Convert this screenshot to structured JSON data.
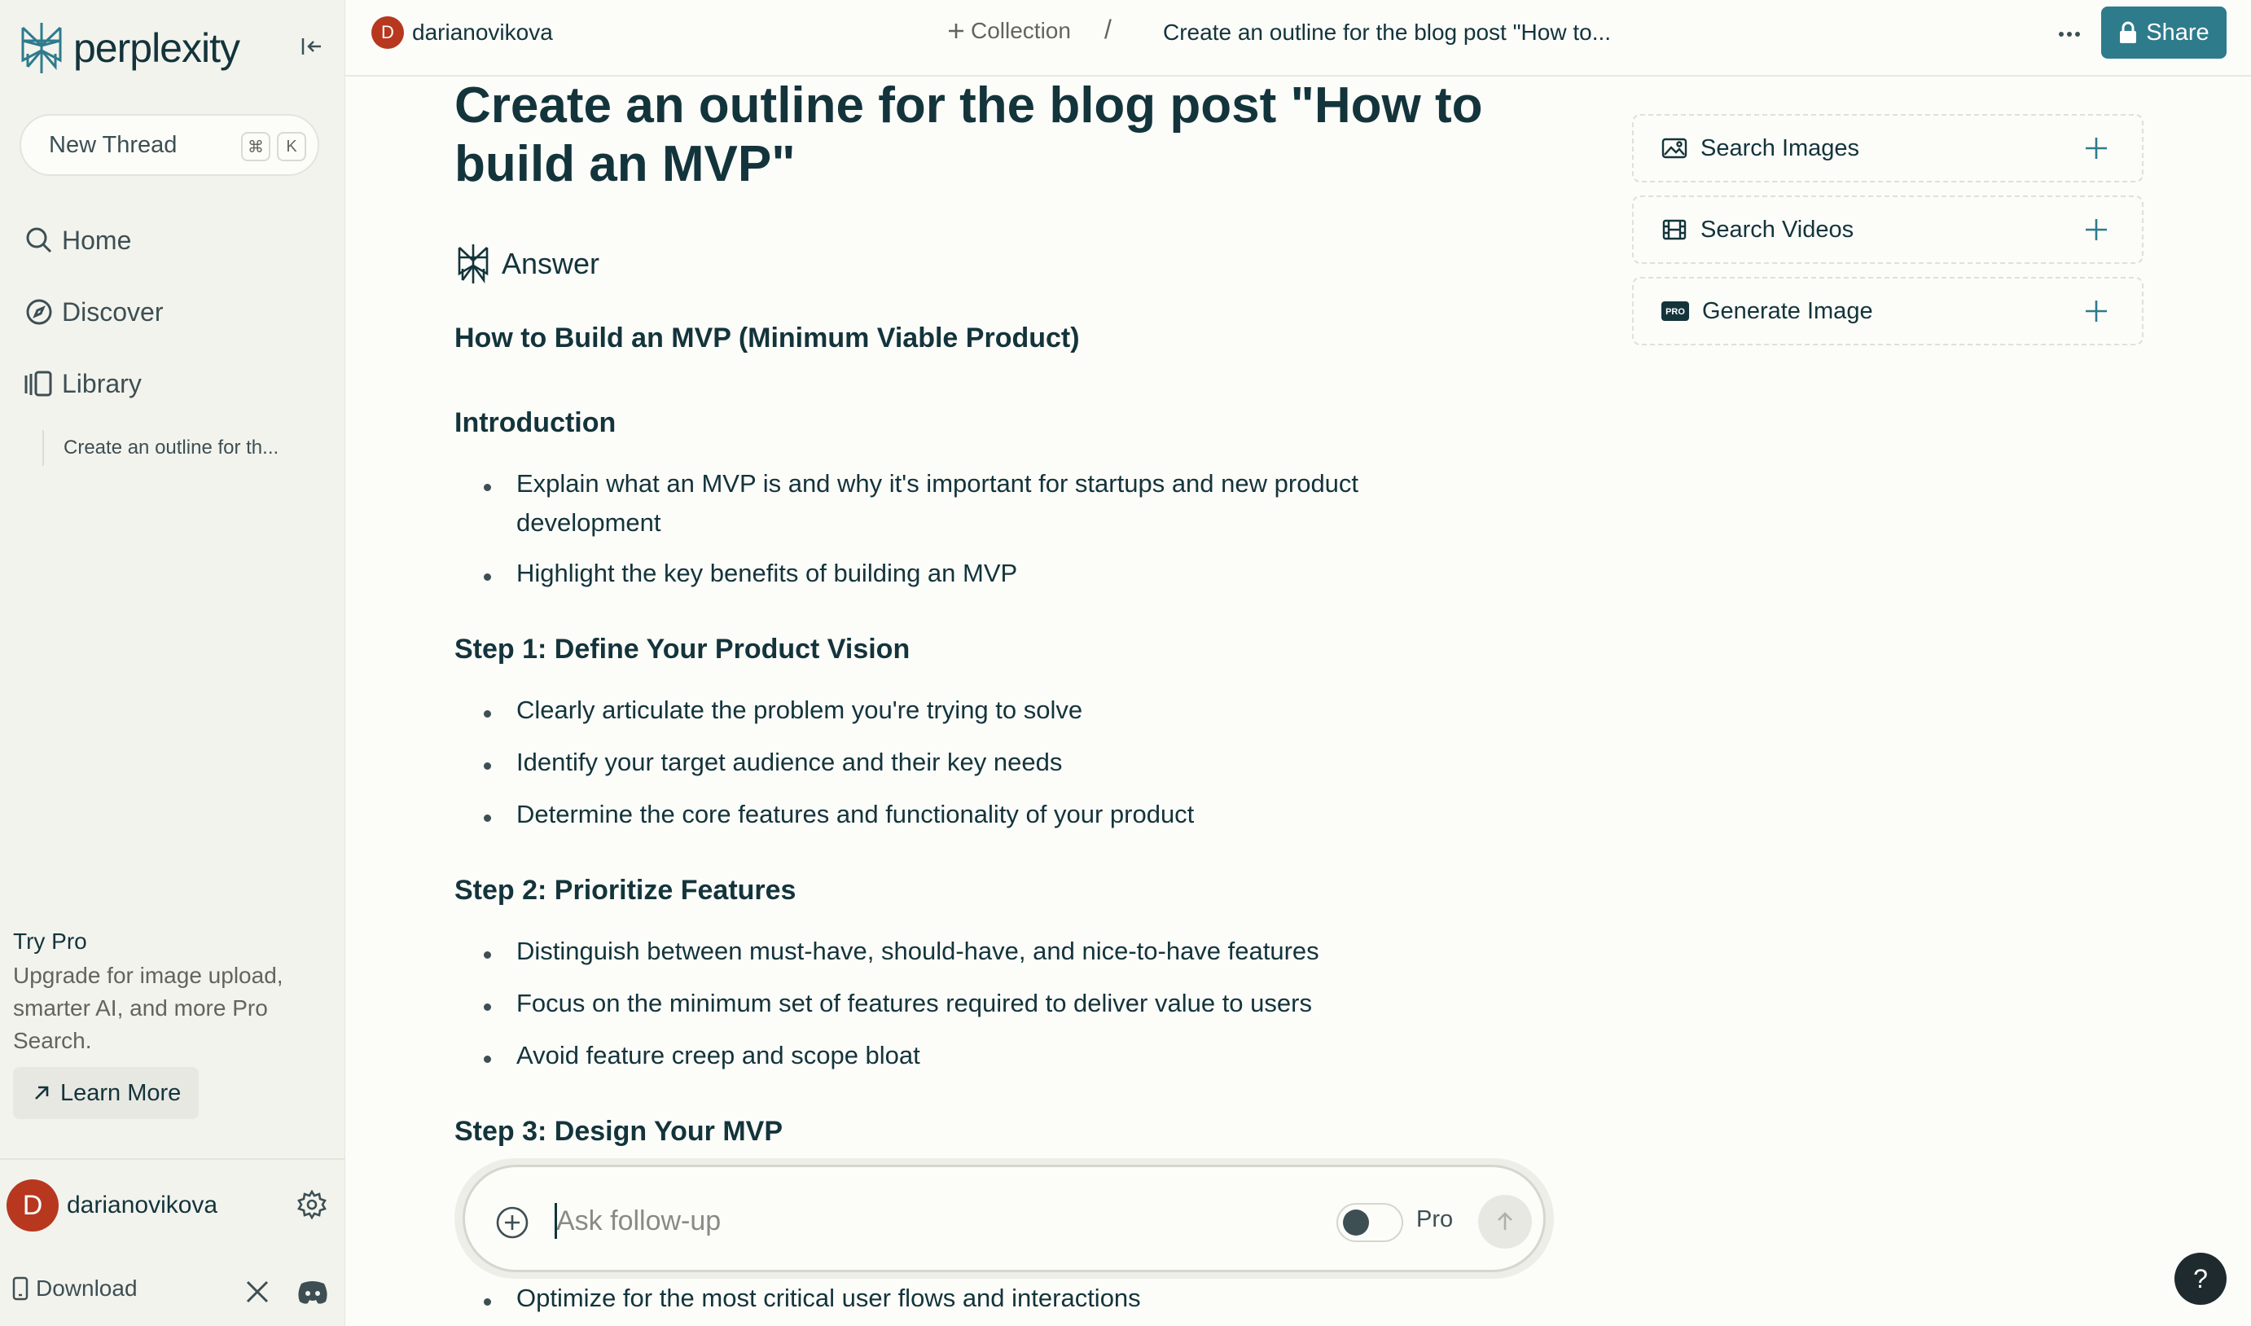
{
  "app": {
    "logo_text": "perplexity"
  },
  "sidebar": {
    "new_thread": {
      "label": "New Thread",
      "kbd": [
        "⌘",
        "K"
      ]
    },
    "nav": [
      {
        "label": "Home",
        "icon": "search-icon"
      },
      {
        "label": "Discover",
        "icon": "compass-icon"
      },
      {
        "label": "Library",
        "icon": "library-icon"
      }
    ],
    "library_items": [
      "Create an outline for th..."
    ],
    "try_pro": {
      "title": "Try Pro",
      "description": "Upgrade for image upload, smarter AI, and more Pro Search.",
      "button": "Learn More"
    },
    "user": {
      "initial": "D",
      "name": "darianovikova"
    },
    "download": "Download"
  },
  "header": {
    "user": {
      "initial": "D",
      "name": "darianovikova"
    },
    "collection": "Collection",
    "separator": "/",
    "thread_title": "Create an outline for the blog post \"How to...",
    "more": "···",
    "share": "Share"
  },
  "main": {
    "question": "Create an outline for the blog post \"How to build an MVP\"",
    "answer_label": "Answer",
    "sections": [
      {
        "heading": "How to Build an MVP (Minimum Viable Product)",
        "bullets": []
      },
      {
        "heading": "Introduction",
        "bullets": [
          "Explain what an MVP is and why it's important for startups and new product development",
          "Highlight the key benefits of building an MVP"
        ]
      },
      {
        "heading": "Step 1: Define Your Product Vision",
        "bullets": [
          "Clearly articulate the problem you're trying to solve",
          "Identify your target audience and their key needs",
          "Determine the core features and functionality of your product"
        ]
      },
      {
        "heading": "Step 2: Prioritize Features",
        "bullets": [
          "Distinguish between must-have, should-have, and nice-to-have features",
          "Focus on the minimum set of features required to deliver value to users",
          "Avoid feature creep and scope bloat"
        ]
      },
      {
        "heading": "Step 3: Design Your MVP",
        "bullets": []
      }
    ],
    "partial_bullet": "Optimize for the most critical user flows and interactions"
  },
  "followup": {
    "placeholder": "Ask follow-up",
    "pro_label": "Pro",
    "pro_enabled": false
  },
  "right_panel": [
    {
      "label": "Search Images",
      "icon": "image-icon"
    },
    {
      "label": "Search Videos",
      "icon": "film-icon"
    },
    {
      "label": "Generate Image",
      "icon": "pro-badge-icon",
      "badge": "PRO"
    }
  ],
  "help": "?",
  "colors": {
    "accent": "#2e7b8c",
    "avatar": "#b7381f",
    "text": "#13343b",
    "background": "#fcfcf9",
    "sidebar": "#f3f3ee"
  }
}
